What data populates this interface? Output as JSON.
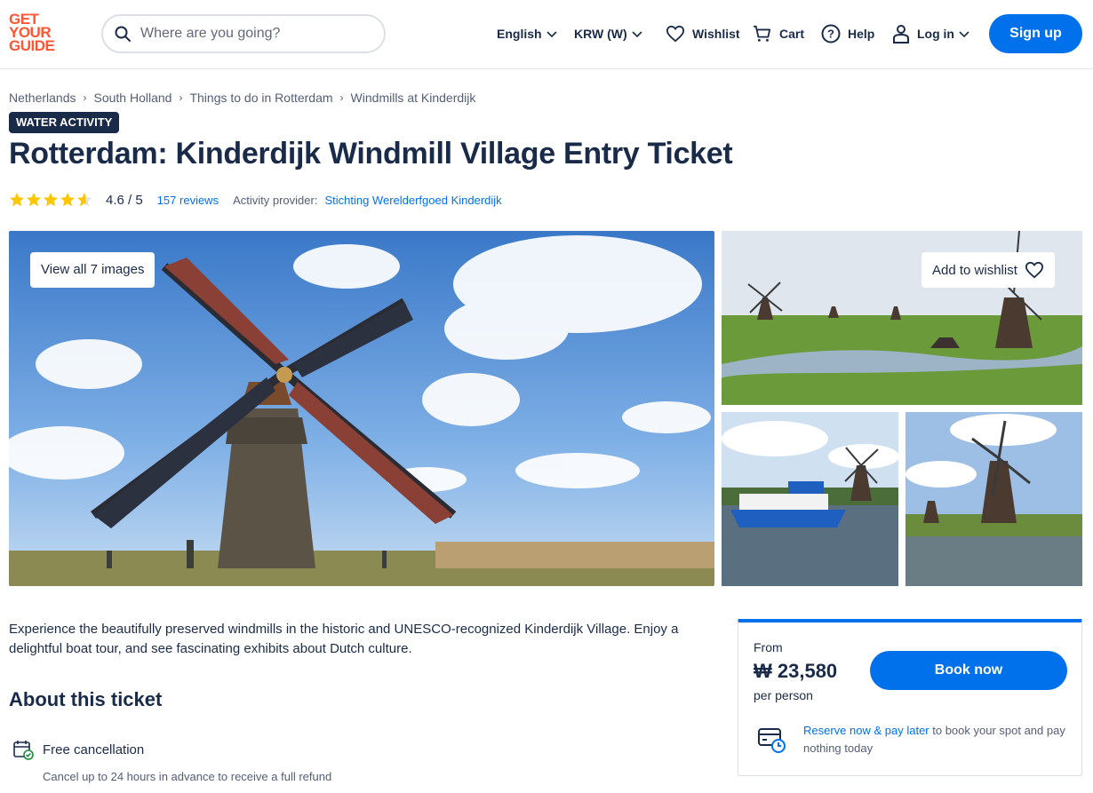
{
  "header": {
    "logo": [
      "GET",
      "YOUR",
      "GUIDE"
    ],
    "search_placeholder": "Where are you going?",
    "language": "English",
    "currency": "KRW (W)",
    "wishlist": "Wishlist",
    "cart": "Cart",
    "help": "Help",
    "login": "Log in",
    "signup": "Sign up"
  },
  "breadcrumb": [
    "Netherlands",
    "South Holland",
    "Things to do in Rotterdam",
    "Windmills at Kinderdijk"
  ],
  "badge": "WATER ACTIVITY",
  "title": "Rotterdam: Kinderdijk Windmill Village Entry Ticket",
  "rating": {
    "score_text": "4.6 / 5",
    "score": 4.6,
    "reviews": "157 reviews",
    "provider_label": "Activity provider:",
    "provider": "Stichting Werelderfgoed Kinderdijk"
  },
  "gallery": {
    "view_all": "View all 7 images",
    "add_wishlist": "Add to wishlist"
  },
  "description": "Experience the beautifully preserved windmills in the historic and UNESCO-recognized Kinderdijk Village. Enjoy a delightful boat tour, and see fascinating exhibits about Dutch culture.",
  "about": {
    "heading": "About this ticket",
    "feature_title": "Free cancellation",
    "feature_sub": "Cancel up to 24 hours in advance to receive a full refund"
  },
  "booking": {
    "from": "From",
    "price": "₩ 23,580",
    "per": "per person",
    "book": "Book now",
    "reserve_link": "Reserve now & pay later",
    "reserve_rest": " to book your spot and pay nothing today"
  },
  "colors": {
    "brand": "#ff5533",
    "primary": "#0071eb",
    "navy": "#1a2b49",
    "star": "#fdc700"
  }
}
